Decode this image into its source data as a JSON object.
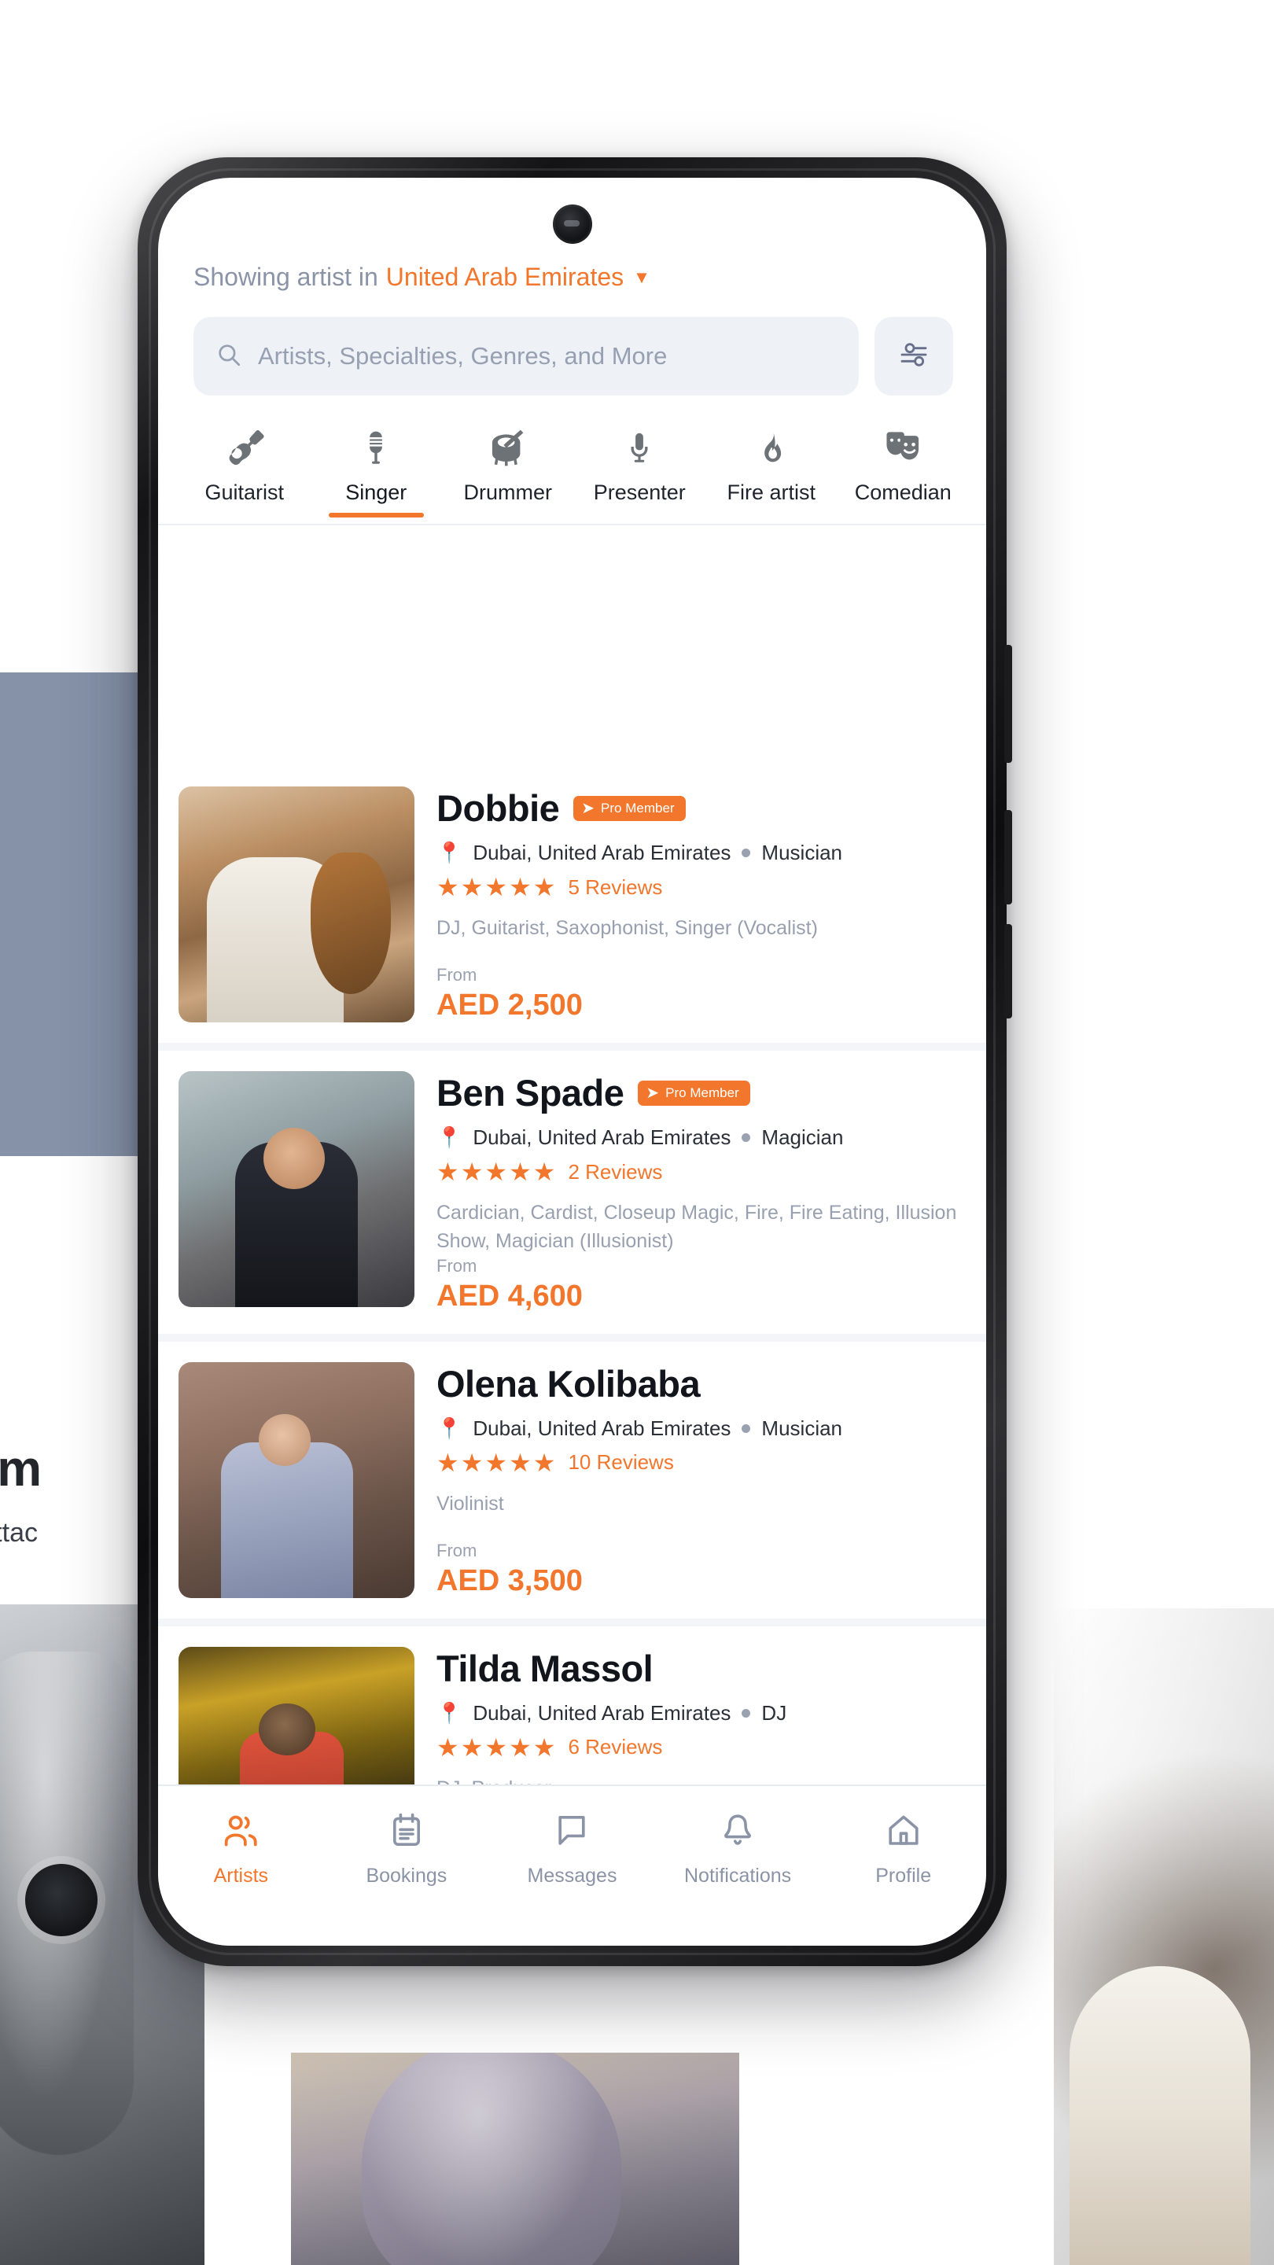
{
  "background": {
    "headline_fragment": "dle m",
    "subline_fragment": "ngs attac"
  },
  "header": {
    "prefix": "Showing artist in",
    "location": "United Arab Emirates",
    "caret_icon": "chevron-down-icon"
  },
  "search": {
    "placeholder": "Artists, Specialties, Genres, and More",
    "search_icon": "search-icon",
    "filter_icon": "filter-sliders-icon"
  },
  "categories": [
    {
      "label": "Guitarist",
      "icon": "guitar-icon",
      "active": false
    },
    {
      "label": "Singer",
      "icon": "microphone-retro-icon",
      "active": true
    },
    {
      "label": "Drummer",
      "icon": "drum-icon",
      "active": false
    },
    {
      "label": "Presenter",
      "icon": "mic-icon",
      "active": false
    },
    {
      "label": "Fire artist",
      "icon": "flame-icon",
      "active": false
    },
    {
      "label": "Comedian",
      "icon": "masks-icon",
      "active": false
    }
  ],
  "artists": [
    {
      "name": "Dobbie",
      "pro_member": true,
      "pro_label": "Pro Member",
      "location": "Dubai, United Arab Emirates",
      "role": "Musician",
      "stars": "★★★★★",
      "reviews": "5 Reviews",
      "specialties": "DJ, Guitarist, Saxophonist, Singer (Vocalist)",
      "from_label": "From",
      "price": "AED 2,500",
      "photo": "saxophonist-photo"
    },
    {
      "name": "Ben Spade",
      "pro_member": true,
      "pro_label": "Pro Member",
      "location": "Dubai, United Arab Emirates",
      "role": "Magician",
      "stars": "★★★★★",
      "reviews": "2 Reviews",
      "specialties": "Cardician, Cardist, Closeup Magic, Fire, Fire Eating, Illusion Show, Magician (Illusionist)",
      "from_label": "From",
      "price": "AED 4,600",
      "photo": "magician-photo"
    },
    {
      "name": "Olena Kolibaba",
      "pro_member": false,
      "pro_label": "",
      "location": "Dubai, United Arab Emirates",
      "role": "Musician",
      "stars": "★★★★★",
      "reviews": "10 Reviews",
      "specialties": "Violinist",
      "from_label": "From",
      "price": "AED 3,500",
      "photo": "violinist-photo"
    },
    {
      "name": "Tilda Massol",
      "pro_member": false,
      "pro_label": "",
      "location": "Dubai, United Arab Emirates",
      "role": "DJ",
      "stars": "★★★★★",
      "reviews": "6 Reviews",
      "specialties": "DJ, Producer",
      "from_label": "",
      "price": "",
      "photo": "dj-photo"
    }
  ],
  "bottom_nav": [
    {
      "label": "Artists",
      "icon": "users-icon",
      "active": true
    },
    {
      "label": "Bookings",
      "icon": "calendar-icon",
      "active": false
    },
    {
      "label": "Messages",
      "icon": "chat-bubble-icon",
      "active": false
    },
    {
      "label": "Notifications",
      "icon": "bell-icon",
      "active": false
    },
    {
      "label": "Profile",
      "icon": "home-icon",
      "active": false
    }
  ],
  "colors": {
    "accent": "#f2762b",
    "muted": "#8b93a6",
    "text": "#12161c",
    "list_bg": "#f3f5f8"
  }
}
